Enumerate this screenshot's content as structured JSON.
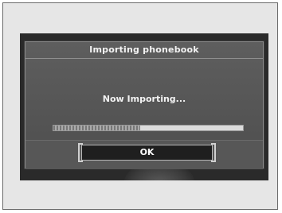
{
  "dialog": {
    "title": "Importing phonebook",
    "status": "Now Importing...",
    "ok_label": "OK"
  },
  "progress": {
    "fraction": 0.46
  },
  "colors": {
    "screen_bg": "#2a2a2a",
    "dialog_bg": "#575757",
    "button_bg": "#1f1f1f",
    "text": "#f2f2f2"
  }
}
